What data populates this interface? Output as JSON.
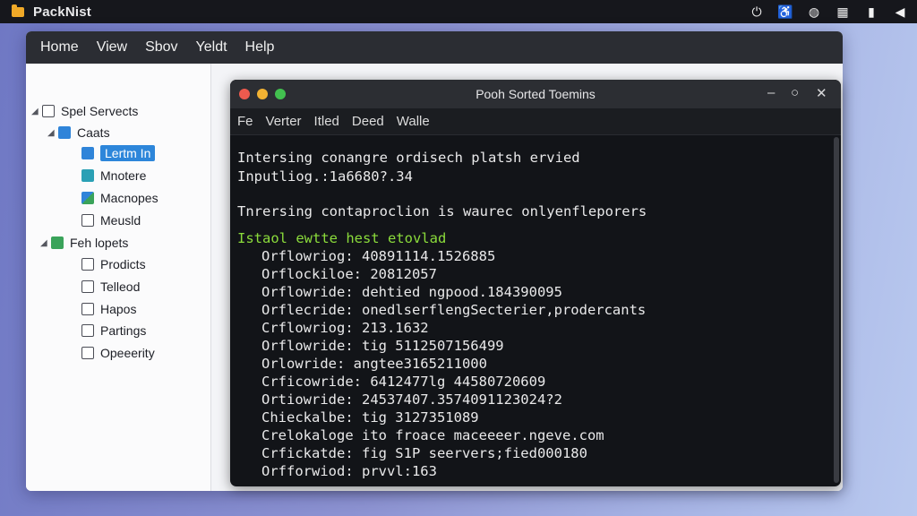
{
  "system_bar": {
    "app_title": "PackNist",
    "tray_icons": [
      "power-icon",
      "accessibility-icon",
      "globe-icon",
      "grid-icon",
      "battery-icon",
      "volume-icon"
    ]
  },
  "menubar": {
    "items": [
      "Home",
      "View",
      "Sbov",
      "Yeldt",
      "Help"
    ]
  },
  "sidebar": {
    "items": [
      {
        "label": "Spel Servects",
        "icon": "document-icon"
      },
      {
        "label": "Caats",
        "icon": "folder-icon"
      },
      {
        "label": "Lertm In",
        "icon": "app-icon"
      },
      {
        "label": "Mnotere",
        "icon": "share-icon"
      },
      {
        "label": "Macnopes",
        "icon": "package-icon"
      },
      {
        "label": "Meusld",
        "icon": "document-icon"
      },
      {
        "label": "Feh lopets",
        "icon": "folder-icon"
      },
      {
        "label": "Prodicts",
        "icon": "document-icon"
      },
      {
        "label": "Telleod",
        "icon": "document-icon"
      },
      {
        "label": "Hapos",
        "icon": "document-icon"
      },
      {
        "label": "Partings",
        "icon": "document-icon"
      },
      {
        "label": "Opeeerity",
        "icon": "document-icon"
      }
    ]
  },
  "terminal": {
    "title": "Pooh Sorted Toemins",
    "menu": [
      "Fe",
      "Verter",
      "Itled",
      "Deed",
      "Walle"
    ],
    "lines": [
      "Intersing conangre ordisech platsh ervied",
      "Inputliog.:1a6680?.34",
      "Tnrersing contaproclion is waurec onlyenfleporers",
      "Istaol ewtte hest etovlad",
      "Orflowriog: 40891114.1526885",
      "Orflockiloe: 20812057",
      "Orflowride: dehtied ngpood.184390095",
      "Orflecride: onedlserflengSecterier,prodercants",
      "Crflowriog: 213.1632",
      "Orflowride: tig 5112507156499",
      "Orlowride: angtee3165211000",
      "Crficowride: 6412477lg 44580720609",
      "Ortiowride: 24537407.3574091123024?2",
      "Chieckalbe: tig 3127351089",
      "Crelokaloge ito froace maceeeer.ngeve.com",
      "Crfickatde: fig S1P seervers;fied000180",
      "Orfforwiod: prvvl:163"
    ]
  },
  "colors": {
    "terminal_bg": "#121418",
    "highlight_green": "#8bdc3b",
    "selection_blue": "#2d86da"
  }
}
